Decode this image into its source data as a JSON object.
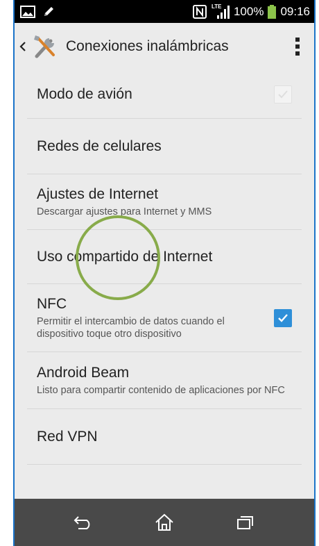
{
  "status_bar": {
    "battery_percent": "100%",
    "time": "09:16",
    "network_label": "LTE"
  },
  "action_bar": {
    "title": "Conexiones inalámbricas"
  },
  "settings": [
    {
      "title": "Modo de avión",
      "summary": "",
      "checkbox": "off"
    },
    {
      "title": "Redes de celulares",
      "summary": "",
      "checkbox": "none"
    },
    {
      "title": "Ajustes de Internet",
      "summary": "Descargar ajustes para Internet y MMS",
      "checkbox": "none"
    },
    {
      "title": "Uso compartido de Internet",
      "summary": "",
      "checkbox": "none"
    },
    {
      "title": "NFC",
      "summary": "Permitir el intercambio de datos cuando el dispositivo toque otro dispositivo",
      "checkbox": "on"
    },
    {
      "title": "Android Beam",
      "summary": "Listo para compartir contenido de aplicaciones por NFC",
      "checkbox": "none"
    },
    {
      "title": "Red VPN",
      "summary": "",
      "checkbox": "none"
    }
  ],
  "icons": {
    "status_left": [
      "image-icon",
      "pencil-icon"
    ],
    "status_right": [
      "nfc-icon",
      "signal-icon",
      "battery-icon"
    ],
    "action": [
      "chevron-left-icon",
      "tools-icon",
      "overflow-menu-icon"
    ],
    "nav": [
      "back-icon",
      "home-icon",
      "recents-icon"
    ]
  },
  "colors": {
    "accent": "#2e8fd8",
    "background": "#ebebeb",
    "nav_bar": "#494949",
    "touch_indicator": "#88ab4a"
  }
}
